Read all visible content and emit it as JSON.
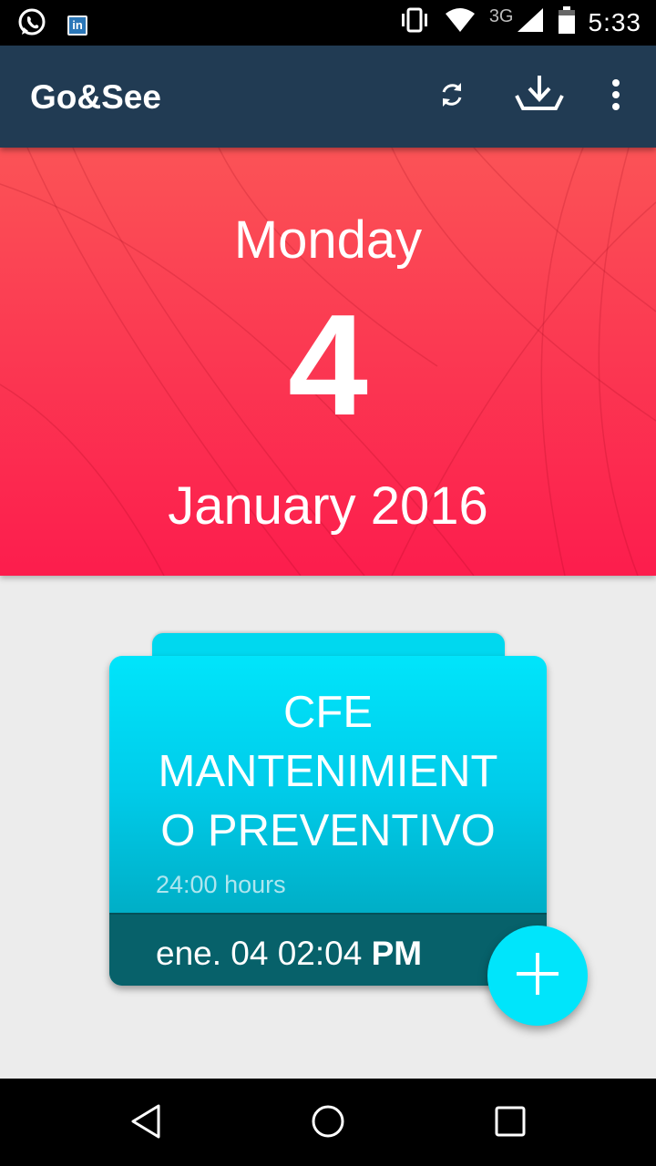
{
  "status_bar": {
    "left_icons": [
      "whatsapp-icon",
      "linkedin-icon"
    ],
    "linkedin_glyph": "in",
    "network_label": "3G",
    "time": "5:33",
    "right_icons": [
      "vibrate-icon",
      "wifi-icon",
      "signal-icon",
      "battery-icon"
    ]
  },
  "app_bar": {
    "title": "Go&See",
    "actions": [
      "sync-icon",
      "download-icon",
      "overflow-menu-icon"
    ],
    "background_color": "#213b53"
  },
  "date_header": {
    "weekday": "Monday",
    "day": "4",
    "month_year": "January 2016",
    "background_color": "#fc1d4d"
  },
  "event_card": {
    "title": "CFE MANTENIMIENT O PREVENTIVO",
    "title_lines": [
      "CFE",
      "MANTENIMIENT",
      "O PREVENTIVO"
    ],
    "duration": "24:00 hours",
    "date_text": "ene. 04 02:04",
    "date_suffix": "PM",
    "accent_color": "#00e5fb"
  },
  "fab": {
    "icon": "plus-icon"
  },
  "nav_bar": {
    "buttons": [
      "back-icon",
      "home-icon",
      "recents-icon"
    ]
  }
}
